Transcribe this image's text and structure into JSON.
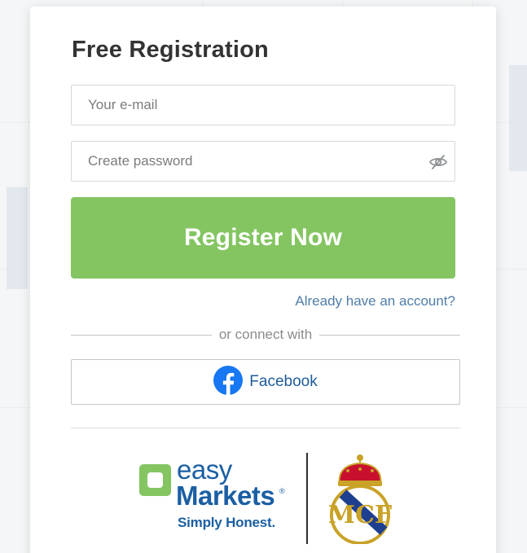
{
  "form": {
    "title": "Free Registration",
    "email_placeholder": "Your e-mail",
    "password_placeholder": "Create password",
    "show_password_icon": "eye-slash-icon",
    "register_label": "Register Now",
    "login_link": "Already have an account?",
    "connect_text": "or connect with",
    "facebook_label": "Facebook",
    "facebook_icon": "facebook-icon"
  },
  "branding": {
    "easy": "easy",
    "markets": "Markets",
    "registered_mark": "®",
    "tagline": "Simply Honest.",
    "partner_logo": "real-madrid-crest"
  },
  "colors": {
    "accent_green": "#84c562",
    "brand_blue": "#1b5fa3",
    "link_blue": "#4f7da8",
    "facebook_blue": "#1877f2"
  }
}
